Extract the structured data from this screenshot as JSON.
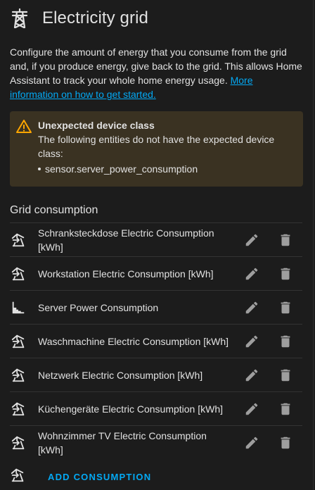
{
  "header": {
    "title": "Electricity grid",
    "icon": "transmission-tower-icon"
  },
  "description": {
    "text": "Configure the amount of energy that you consume from the grid and, if you produce energy, give back to the grid. This allows Home Assistant to track your whole home energy usage. ",
    "link": "More information on how to get started."
  },
  "alert": {
    "title": "Unexpected device class",
    "message": "The following entities do not have the expected device class:",
    "items": [
      "sensor.server_power_consumption"
    ],
    "color": "#ffa600"
  },
  "section": {
    "title": "Grid consumption"
  },
  "consumptions": [
    {
      "label": "Schranksteckdose Electric Consumption [kWh]",
      "icon": "transmission-tower-import-icon"
    },
    {
      "label": "Workstation Electric Consumption [kWh]",
      "icon": "transmission-tower-import-icon"
    },
    {
      "label": "Server Power Consumption",
      "icon": "chart-step-icon"
    },
    {
      "label": "Waschmachine Electric Consumption [kWh]",
      "icon": "transmission-tower-import-icon"
    },
    {
      "label": "Netzwerk Electric Consumption [kWh]",
      "icon": "transmission-tower-import-icon"
    },
    {
      "label": "Küchengeräte Electric Consumption [kWh]",
      "icon": "transmission-tower-import-icon"
    },
    {
      "label": "Wohnzimmer TV Electric Consumption [kWh]",
      "icon": "transmission-tower-import-icon"
    }
  ],
  "add_button": {
    "label": "ADD CONSUMPTION"
  },
  "colors": {
    "accent": "#03a9f4",
    "warning_bg": "#3a3222",
    "icon": "#e1e1e1",
    "action_icon": "#9e9e9e"
  }
}
